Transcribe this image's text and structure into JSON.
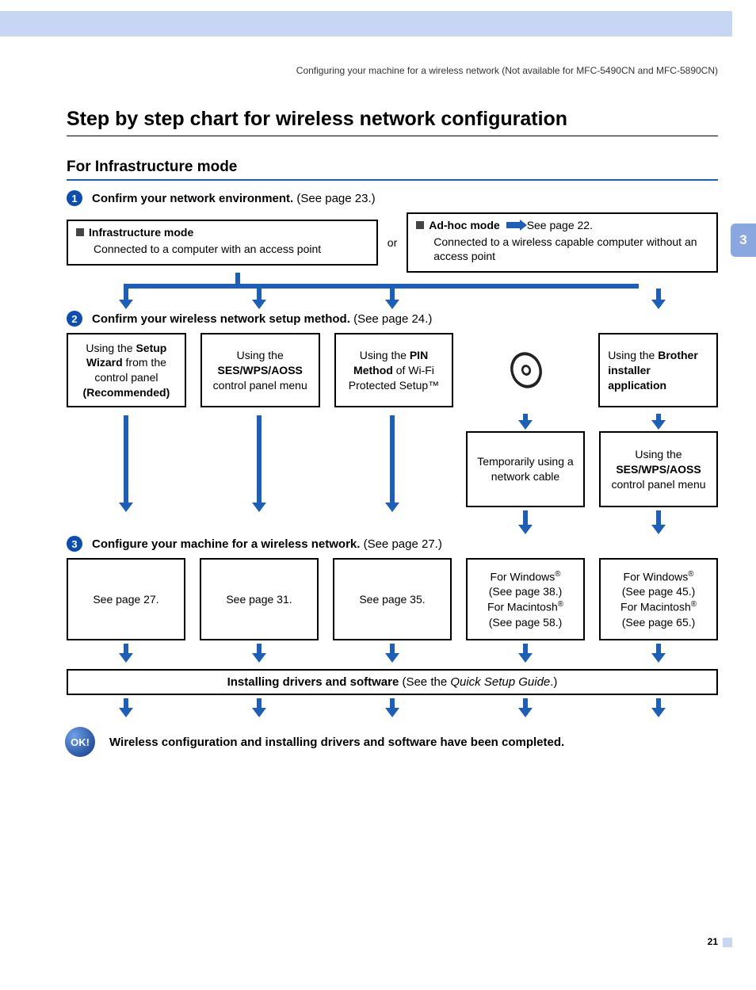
{
  "header": "Configuring your machine for a wireless network (Not available for MFC-5490CN and MFC-5890CN)",
  "chapter": "3",
  "title": "Step by step chart for wireless network configuration",
  "subtitle": "For Infrastructure mode",
  "step1": {
    "bold": "Confirm your network environment.",
    "ref": " (See page 23.)"
  },
  "mode_left": {
    "title": "Infrastructure mode",
    "desc": "Connected to a computer with an access point"
  },
  "or": "or",
  "mode_right": {
    "title": "Ad-hoc mode",
    "ref": " See page 22.",
    "desc": "Connected to a wireless capable computer without an access point"
  },
  "step2": {
    "bold": "Confirm your wireless network setup method.",
    "ref": " (See page 24.)"
  },
  "methods": {
    "m1": {
      "pre": "Using the ",
      "b1": "Setup Wizard",
      "mid": " from the control panel ",
      "b2": "(Recommended)"
    },
    "m2": {
      "pre": "Using the ",
      "b1": "SES/WPS/AOSS",
      "post": " control panel menu"
    },
    "m3": {
      "pre": "Using the ",
      "b1": "PIN Method",
      "post": " of Wi-Fi Protected Setup™"
    },
    "m5": {
      "pre": "Using the ",
      "b1": "Brother installer application"
    }
  },
  "sub": {
    "s4": "Temporarily using a network cable",
    "s5": {
      "pre": "Using the ",
      "b1": "SES/WPS/AOSS",
      "post": " control panel menu"
    }
  },
  "step3": {
    "bold": "Configure your machine for a wireless network.",
    "ref": " (See page 27.)"
  },
  "refs": {
    "r1": "See page 27.",
    "r2": "See page 31.",
    "r3": "See page 35.",
    "r4": {
      "w": "For Windows",
      "wref": "(See page 38.)",
      "m": "For Macintosh",
      "mref": "(See page 58.)"
    },
    "r5": {
      "w": "For Windows",
      "wref": "(See page 45.)",
      "m": "For Macintosh",
      "mref": "(See page 65.)"
    }
  },
  "install": {
    "bold": "Installing drivers and software",
    "rest": " (See the ",
    "italic": "Quick Setup Guide",
    "end": ".)"
  },
  "ok": "OK!",
  "complete": "Wireless configuration and installing drivers and software have been completed.",
  "pagenum": "21"
}
